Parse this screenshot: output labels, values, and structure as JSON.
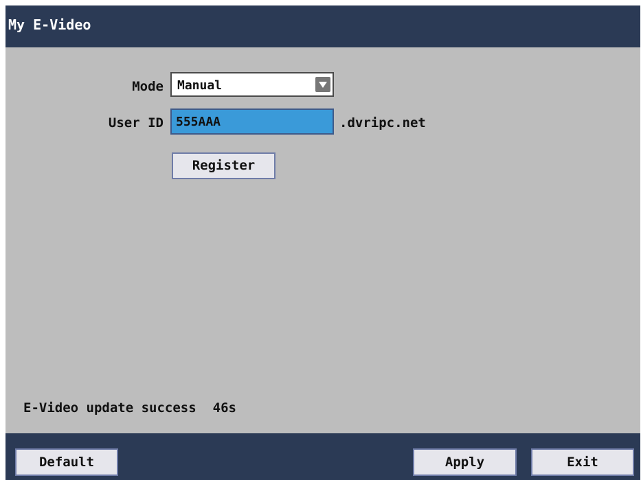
{
  "window": {
    "title": "My E-Video"
  },
  "form": {
    "mode_label": "Mode",
    "mode_value": "Manual",
    "user_id_label": "User ID",
    "user_id_value": "555AAA",
    "domain_suffix": ".dvripc.net",
    "register_label": "Register"
  },
  "status": {
    "message": "E-Video update success",
    "value": "46s"
  },
  "footer": {
    "default_label": "Default",
    "apply_label": "Apply",
    "exit_label": "Exit"
  },
  "colors": {
    "titlebar": "#2b3a55",
    "panel": "#bdbdbd",
    "input_highlight": "#3a9ad9",
    "button_face": "#e6e6ec"
  },
  "icons": {
    "dropdown": "chevron-down-icon"
  }
}
